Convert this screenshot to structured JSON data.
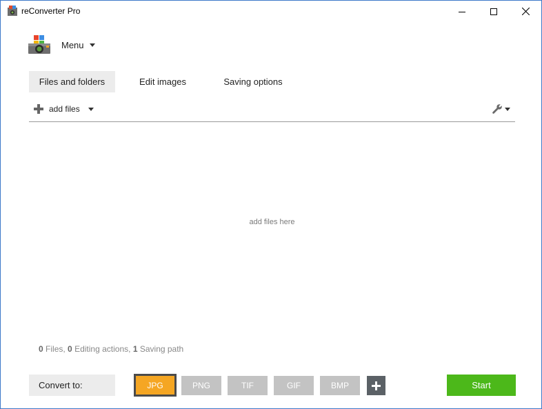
{
  "window": {
    "title": "reConverter Pro"
  },
  "menu": {
    "label": "Menu"
  },
  "tabs": [
    {
      "label": "Files and folders",
      "active": true
    },
    {
      "label": "Edit images",
      "active": false
    },
    {
      "label": "Saving options",
      "active": false
    }
  ],
  "toolbar": {
    "add_files_label": "add files"
  },
  "drop_area": {
    "hint": "add files here"
  },
  "status": {
    "files_count": "0",
    "files_label": "Files,",
    "editing_count": "0",
    "editing_label": "Editing actions,",
    "saving_count": "1",
    "saving_label": "Saving path"
  },
  "convert": {
    "label": "Convert to:",
    "formats": [
      "JPG",
      "PNG",
      "TIF",
      "GIF",
      "BMP"
    ],
    "selected": "JPG"
  },
  "start_label": "Start",
  "colors": {
    "accent_selected": "#f5a623",
    "start_green": "#4cb81a",
    "format_gray": "#c3c3c3",
    "window_border": "#3c78c8"
  }
}
